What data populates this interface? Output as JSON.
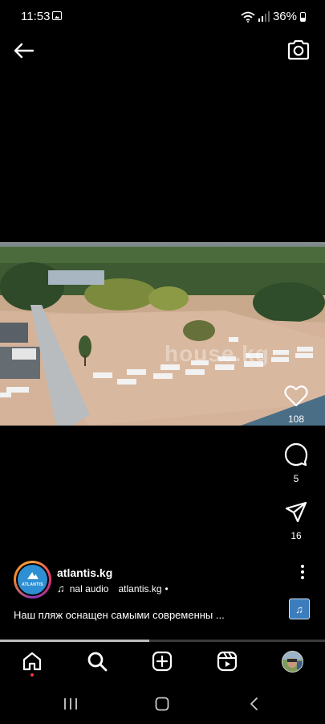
{
  "status": {
    "time": "11:53",
    "battery": "36%",
    "icons": [
      "gallery-icon",
      "wifi-icon",
      "signal-icon",
      "battery-icon"
    ]
  },
  "header": {
    "back_icon": "arrow-left-icon",
    "camera_icon": "camera-icon"
  },
  "photo": {
    "watermark": "house.kg"
  },
  "actions": {
    "likes": "108",
    "comments": "5",
    "shares": "16"
  },
  "post": {
    "username": "atlantis.kg",
    "avatar_text": "ATLANTIS",
    "audio_track": "nal audio",
    "audio_creator": "atlantis.kg",
    "audio_separator": "•",
    "caption": "Наш пляж оснащен  самыми современны ..."
  },
  "progress": {
    "fraction": 0.46
  },
  "bottom_nav": {
    "items": [
      "home-icon",
      "search-icon",
      "create-icon",
      "reels-icon",
      "profile-avatar"
    ]
  },
  "colors": {
    "background": "#000000",
    "notification_dot": "#ff3040",
    "music_thumb": "#3b7dbd"
  }
}
